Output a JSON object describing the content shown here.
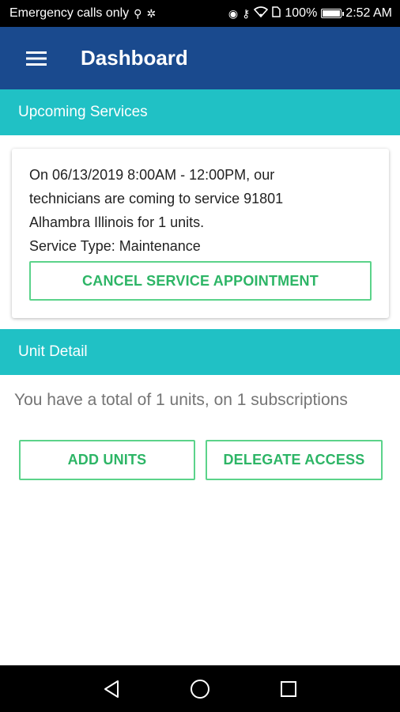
{
  "status_bar": {
    "carrier": "Emergency calls only",
    "battery": "100%",
    "time": "2:52 AM"
  },
  "app_bar": {
    "title": "Dashboard"
  },
  "upcoming_services": {
    "header": "Upcoming Services",
    "card": {
      "line1": "On 06/13/2019 8:00AM - 12:00PM, our",
      "line2": "technicians are coming to service 91801",
      "line3": "Alhambra Illinois for 1 units.",
      "line4": "Service Type: Maintenance",
      "cancel_label": "CANCEL SERVICE APPOINTMENT"
    }
  },
  "unit_detail": {
    "header": "Unit Detail",
    "summary": "You have a total of 1 units, on 1 subscriptions",
    "add_units_label": "ADD UNITS",
    "delegate_access_label": "DELEGATE ACCESS"
  },
  "colors": {
    "app_bar": "#1a4a8e",
    "section_header": "#20c1c5",
    "button_accent": "#2db566"
  }
}
